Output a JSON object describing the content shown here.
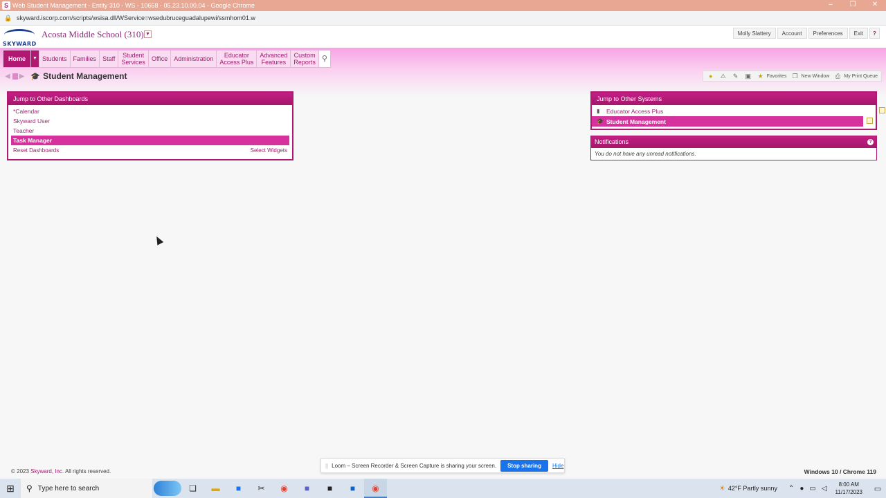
{
  "browser": {
    "window_title": "Web Student Management - Entity 310 - WS - 10668 - 05.23.10.00.04 - Google Chrome",
    "url": "skyward.iscorp.com/scripts/wsisa.dll/WService=wsedubruceguadalupewi/ssmhom01.w"
  },
  "header": {
    "logo_text": "SKYWARD",
    "school": "Acosta Middle School (310)",
    "user_links": [
      "Molly Slattery",
      "Account",
      "Preferences",
      "Exit",
      "?"
    ]
  },
  "nav": {
    "items": [
      {
        "label": "Home",
        "active": true
      },
      {
        "label": "Students"
      },
      {
        "label": "Families"
      },
      {
        "label": "Staff"
      },
      {
        "label": "Student\nServices"
      },
      {
        "label": "Office"
      },
      {
        "label": "Administration"
      },
      {
        "label": "Educator\nAccess Plus"
      },
      {
        "label": "Advanced\nFeatures"
      },
      {
        "label": "Custom\nReports"
      }
    ]
  },
  "page": {
    "title": "Student Management"
  },
  "toolbar": {
    "favorites": "Favorites",
    "new_window": "New Window",
    "print_queue": "My Print Queue"
  },
  "dashboards_panel": {
    "title": "Jump to Other Dashboards",
    "items": [
      "*Calendar",
      "Skyward User",
      "Teacher",
      "Task Manager"
    ],
    "selected": "Task Manager",
    "reset": "Reset Dashboards",
    "select_widgets": "Select Widgets"
  },
  "systems_panel": {
    "title": "Jump to Other Systems",
    "items": [
      "Educator Access Plus",
      "Student Management"
    ],
    "selected": "Student Management"
  },
  "notifications_panel": {
    "title": "Notifications",
    "message": "You do not have any unread notifications."
  },
  "footer": {
    "copyright_prefix": "© 2023 ",
    "copyright_link": "Skyward, Inc.",
    "copyright_suffix": " All rights reserved.",
    "browser_info": "Windows 10 / Chrome 119"
  },
  "loom": {
    "message": "Loom – Screen Recorder & Screen Capture is sharing your screen.",
    "stop": "Stop sharing",
    "hide": "Hide"
  },
  "taskbar": {
    "search_placeholder": "Type here to search",
    "weather": "42°F  Partly sunny",
    "time": "8:00 AM",
    "date": "11/17/2023"
  },
  "colors": {
    "brand": "#a0216d",
    "panel_header": "#b01872",
    "selected_row": "#d6329d",
    "title_bar": "#e8a792"
  }
}
